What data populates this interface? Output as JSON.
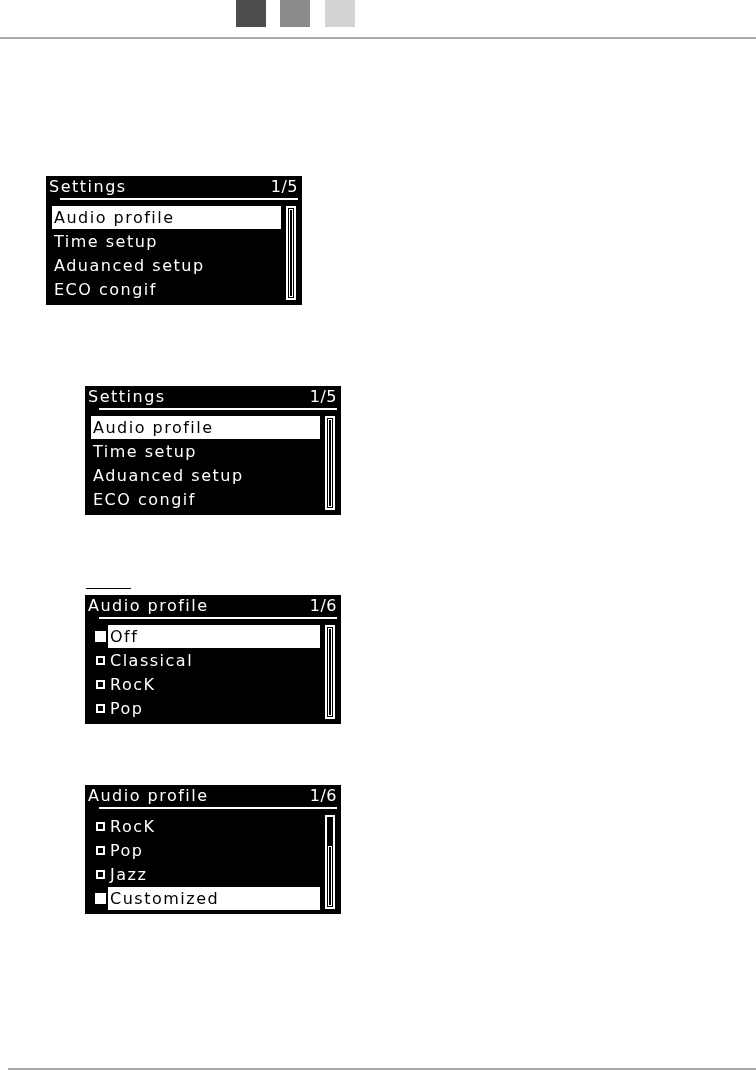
{
  "screens": [
    {
      "kind": "menu",
      "title": "Settings",
      "page": "1/5",
      "scrolled_down": false,
      "items": [
        {
          "label": "Audio profile",
          "selected": true
        },
        {
          "label": "Time setup",
          "selected": false
        },
        {
          "label": "Aduanced setup",
          "selected": false
        },
        {
          "label": "ECO congif",
          "selected": false
        }
      ]
    },
    {
      "kind": "menu",
      "title": "Settings",
      "page": "1/5",
      "scrolled_down": false,
      "items": [
        {
          "label": "Audio profile",
          "selected": true
        },
        {
          "label": "Time setup",
          "selected": false
        },
        {
          "label": "Aduanced setup",
          "selected": false
        },
        {
          "label": "ECO congif",
          "selected": false
        }
      ]
    },
    {
      "kind": "options",
      "title": "Audio profile",
      "page": "1/6",
      "scrolled_down": false,
      "items": [
        {
          "label": "Off",
          "selected": true
        },
        {
          "label": "Classical",
          "selected": false
        },
        {
          "label": "RocK",
          "selected": false
        },
        {
          "label": "Pop",
          "selected": false
        }
      ]
    },
    {
      "kind": "options",
      "title": "Audio profile",
      "page": "1/6",
      "scrolled_down": true,
      "items": [
        {
          "label": "RocK",
          "selected": false
        },
        {
          "label": "Pop",
          "selected": false
        },
        {
          "label": "Jazz",
          "selected": false
        },
        {
          "label": "Customized",
          "selected": true
        }
      ]
    }
  ]
}
